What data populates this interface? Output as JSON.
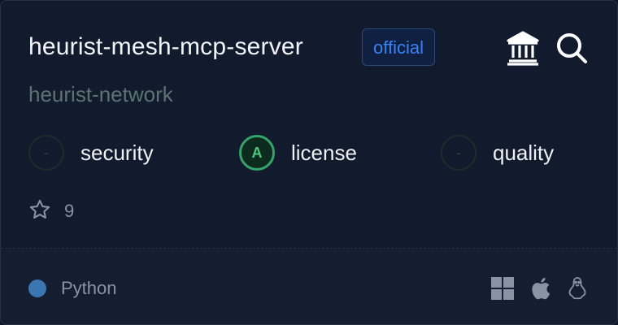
{
  "server": {
    "name": "heurist-mesh-mcp-server",
    "badge": "official",
    "owner": "heurist-network"
  },
  "header_icons": [
    {
      "name": "bank-icon"
    },
    {
      "name": "search-icon"
    }
  ],
  "scores": [
    {
      "grade": "-",
      "label": "security",
      "state": "empty"
    },
    {
      "grade": "A",
      "label": "license",
      "state": "good"
    },
    {
      "grade": "-",
      "label": "quality",
      "state": "empty"
    }
  ],
  "stars": {
    "count": "9",
    "icon": "star-icon"
  },
  "footer": {
    "language": "Python",
    "language_color": "#3b76b0",
    "platforms": [
      "windows-icon",
      "apple-icon",
      "linux-icon"
    ]
  },
  "colors": {
    "background": "#121b2e",
    "badge_text": "#3b82f6",
    "grade_good": "#35a46a",
    "owner_text": "#5c7470"
  }
}
